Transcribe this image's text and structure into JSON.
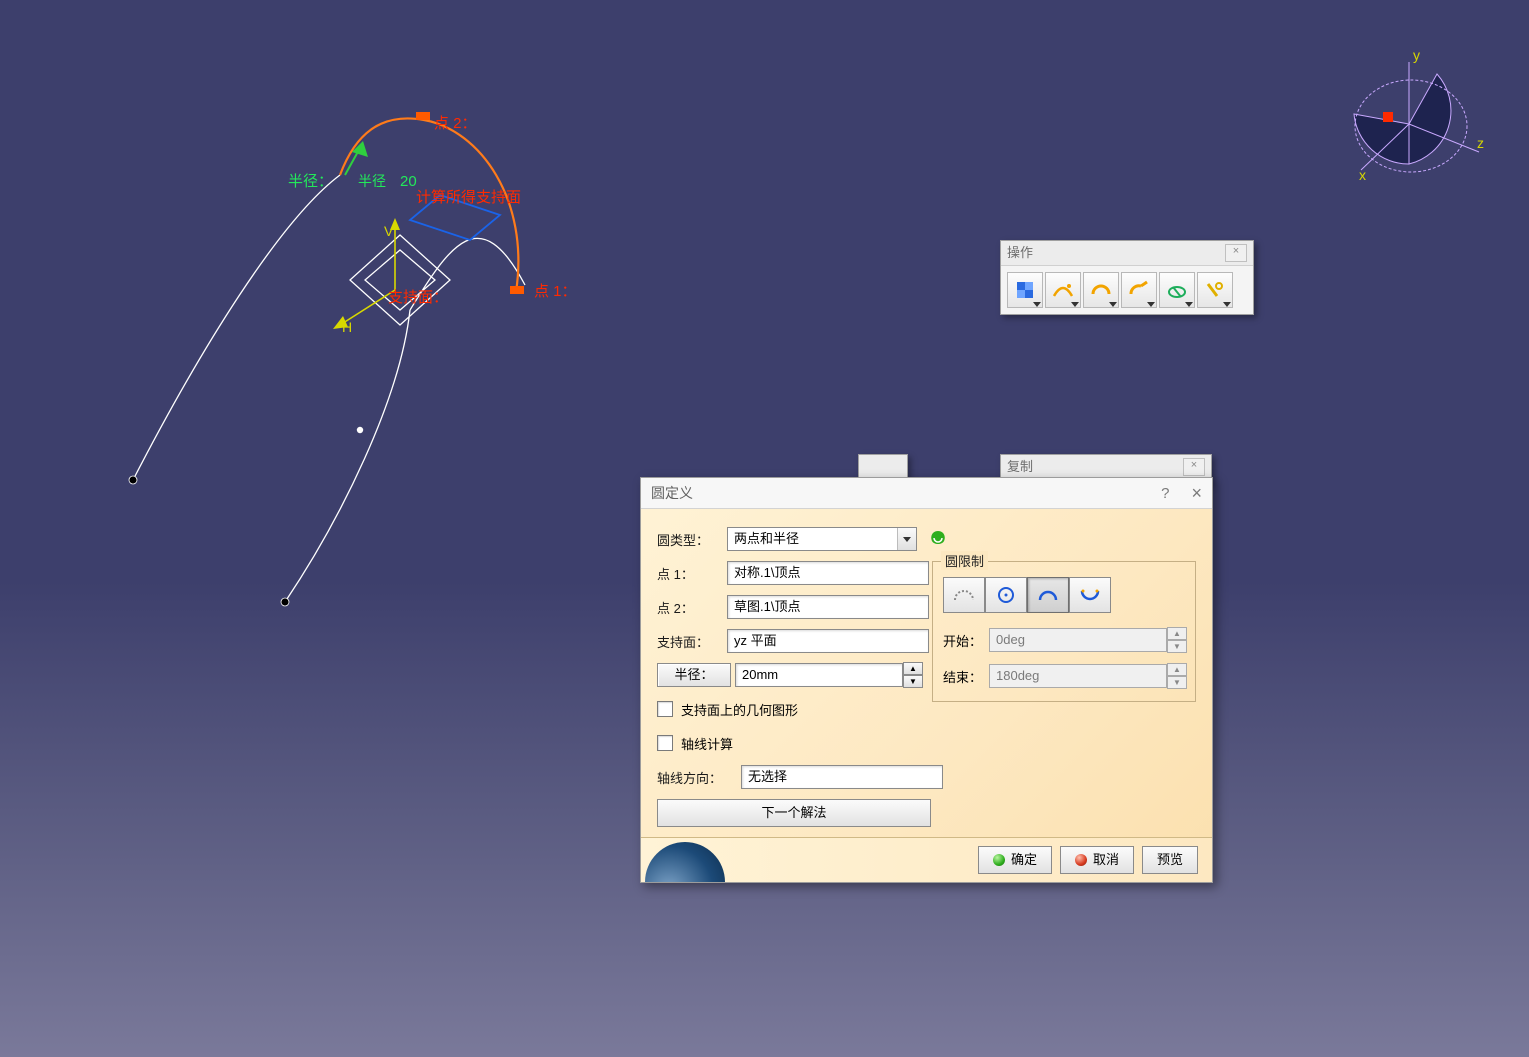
{
  "compass": {
    "x": "x",
    "y": "y",
    "z": "z"
  },
  "scene_labels": {
    "point1": "点 1：",
    "point2": "点 2：",
    "radius_label": "半径：",
    "radius_hint": "半径",
    "radius_value": "20",
    "support_calc": "计算所得支持面",
    "support_face": "支持面：",
    "h_axis": "H",
    "v_axis": "V"
  },
  "toolbar_ops": {
    "title": "操作",
    "items": [
      "join-icon",
      "heal-icon",
      "untrim-icon",
      "disassemble-icon",
      "split-icon",
      "trim-icon"
    ]
  },
  "toolbar_copy": {
    "title": "复制"
  },
  "dialog": {
    "title": "圆定义",
    "labels": {
      "circle_type": "圆类型：",
      "point1": "点 1：",
      "point2": "点 2：",
      "support": "支持面：",
      "radius": "半径：",
      "geom_on_support": "支持面上的几何图形",
      "axis_compute": "轴线计算",
      "axis_dir": "轴线方向：",
      "limit_group": "圆限制",
      "start": "开始：",
      "end": "结束：",
      "next_solution": "下一个解法"
    },
    "values": {
      "circle_type": "两点和半径",
      "point1": "对称.1\\顶点",
      "point2": "草图.1\\顶点",
      "support": "yz 平面",
      "radius": "20mm",
      "axis_dir": "无选择",
      "start": "0deg",
      "end": "180deg"
    },
    "buttons": {
      "ok": "确定",
      "cancel": "取消",
      "preview": "预览"
    }
  }
}
